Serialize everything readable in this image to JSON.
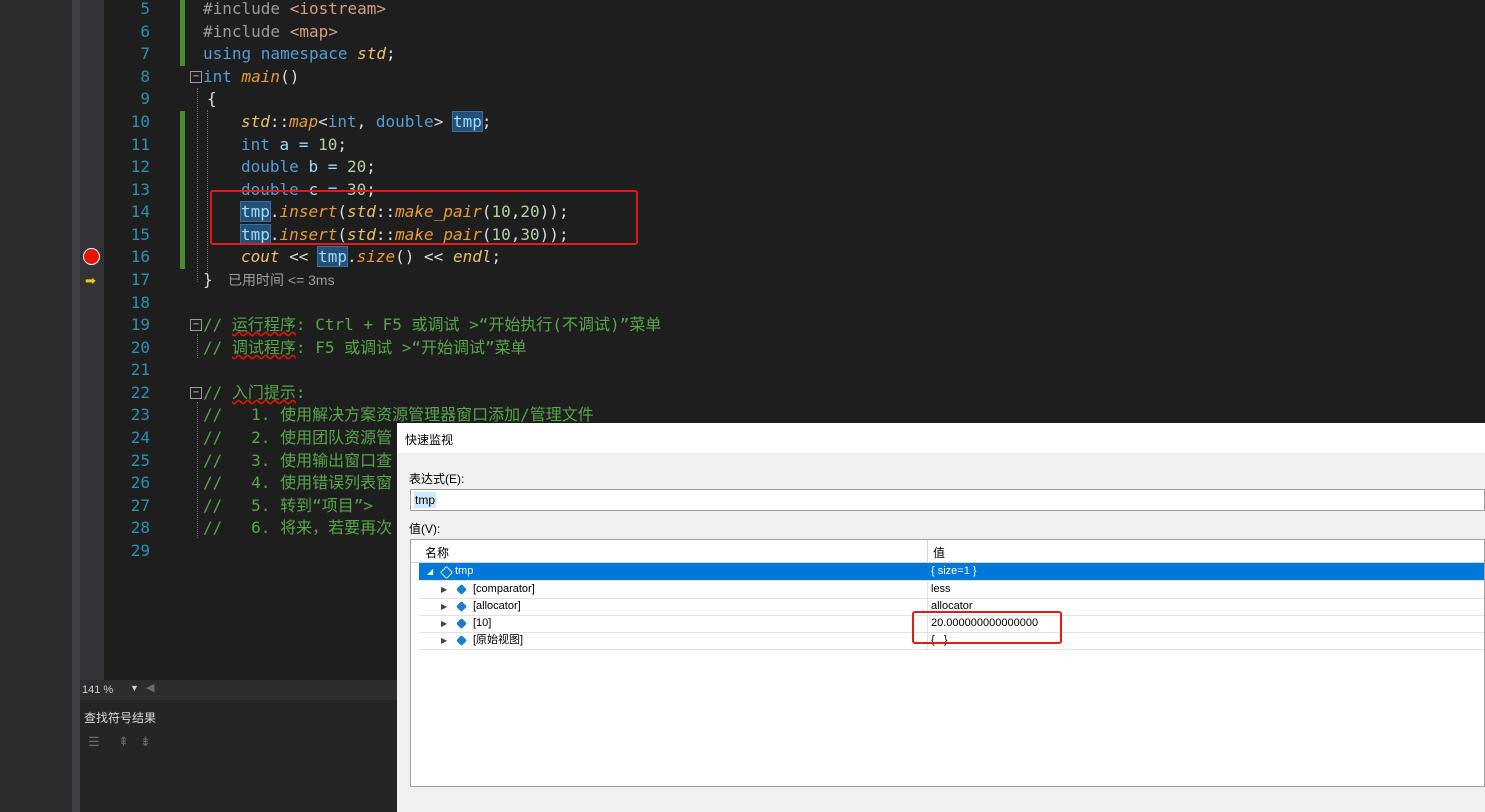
{
  "editor": {
    "lines": [
      {
        "n": "5"
      },
      {
        "n": "6"
      },
      {
        "n": "7"
      },
      {
        "n": "8"
      },
      {
        "n": "9"
      },
      {
        "n": "10"
      },
      {
        "n": "11"
      },
      {
        "n": "12"
      },
      {
        "n": "13"
      },
      {
        "n": "14"
      },
      {
        "n": "15"
      },
      {
        "n": "16"
      },
      {
        "n": "17"
      },
      {
        "n": "18"
      },
      {
        "n": "19"
      },
      {
        "n": "20"
      },
      {
        "n": "21"
      },
      {
        "n": "22"
      },
      {
        "n": "23"
      },
      {
        "n": "24"
      },
      {
        "n": "25"
      },
      {
        "n": "26"
      },
      {
        "n": "27"
      },
      {
        "n": "28"
      },
      {
        "n": "29"
      }
    ],
    "code": {
      "l5_a": "#include ",
      "l5_b": "<iostream>",
      "l6_a": "#include ",
      "l6_b": "<map>",
      "l7_a": "using namespace ",
      "l7_b": "std",
      "l7_c": ";",
      "l8_a": "int ",
      "l8_b": "main",
      "l8_c": "()",
      "l9": "{",
      "l10_a": "std",
      "l10_b": "::",
      "l10_c": "map",
      "l10_d": "<",
      "l10_e": "int",
      "l10_f": ", ",
      "l10_g": "double",
      "l10_h": "> ",
      "l10_i": "tmp",
      "l10_j": ";",
      "l11_a": "int ",
      "l11_b": "a = ",
      "l11_c": "10",
      "l11_d": ";",
      "l12_a": "double ",
      "l12_b": "b = ",
      "l12_c": "20",
      "l12_d": ";",
      "l13_a": "double ",
      "l13_b": "c = ",
      "l13_c": "30",
      "l13_d": ";",
      "l14_a": "tmp",
      "l14_b": ".",
      "l14_c": "insert",
      "l14_d": "(",
      "l14_e": "std",
      "l14_f": "::",
      "l14_g": "make_pair",
      "l14_h": "(",
      "l14_i": "10",
      "l14_j": ",",
      "l14_k": "20",
      "l14_l": "));",
      "l15_a": "tmp",
      "l15_b": ".",
      "l15_c": "insert",
      "l15_d": "(",
      "l15_e": "std",
      "l15_f": "::",
      "l15_g": "make_pair",
      "l15_h": "(",
      "l15_i": "10",
      "l15_j": ",",
      "l15_k": "30",
      "l15_l": "));",
      "l16_a": "cout",
      "l16_b": " << ",
      "l16_c": "tmp",
      "l16_d": ".",
      "l16_e": "size",
      "l16_f": "()",
      "l16_g": " << ",
      "l16_h": "endl",
      "l16_i": ";",
      "l17": "}",
      "l19_a": "// ",
      "l19_b": "运行程序",
      "l19_c": ": Ctrl + F5 或调试 >“开始执行(不调试)”菜单",
      "l20_a": "// ",
      "l20_b": "调试程序",
      "l20_c": ": F5 或调试 >“开始调试”菜单",
      "l22_a": "// ",
      "l22_b": "入门提示",
      "l22_c": ":",
      "l23": "//   1. 使用解决方案资源管理器窗口添加/管理文件",
      "l24": "//   2. 使用团队资源管",
      "l25": "//   3. 使用输出窗口查",
      "l26": "//   4. 使用错误列表窗",
      "l27": "//   5. 转到“项目”>",
      "l28": "//   6. 将来，若要再次"
    },
    "elapsed": "已用时间 <= 3ms"
  },
  "status": {
    "zoom": "141 %"
  },
  "find_panel": {
    "title": "查找符号结果"
  },
  "quickwatch": {
    "title": "快速监视",
    "expression_label": "表达式(E):",
    "expression_value": "tmp",
    "value_label": "值(V):",
    "columns": {
      "name": "名称",
      "value": "值"
    },
    "rows": [
      {
        "name": "tmp",
        "value": "{ size=1 }"
      },
      {
        "name": "[comparator]",
        "value": "less"
      },
      {
        "name": "[allocator]",
        "value": "allocator"
      },
      {
        "name": "[10]",
        "value": "20.000000000000000"
      },
      {
        "name": "[原始视图]",
        "value": "{...}"
      }
    ]
  },
  "colors": {
    "breakpoint": "#e51400",
    "highlight_box": "#e31b1b",
    "selection": "#0078d7"
  }
}
